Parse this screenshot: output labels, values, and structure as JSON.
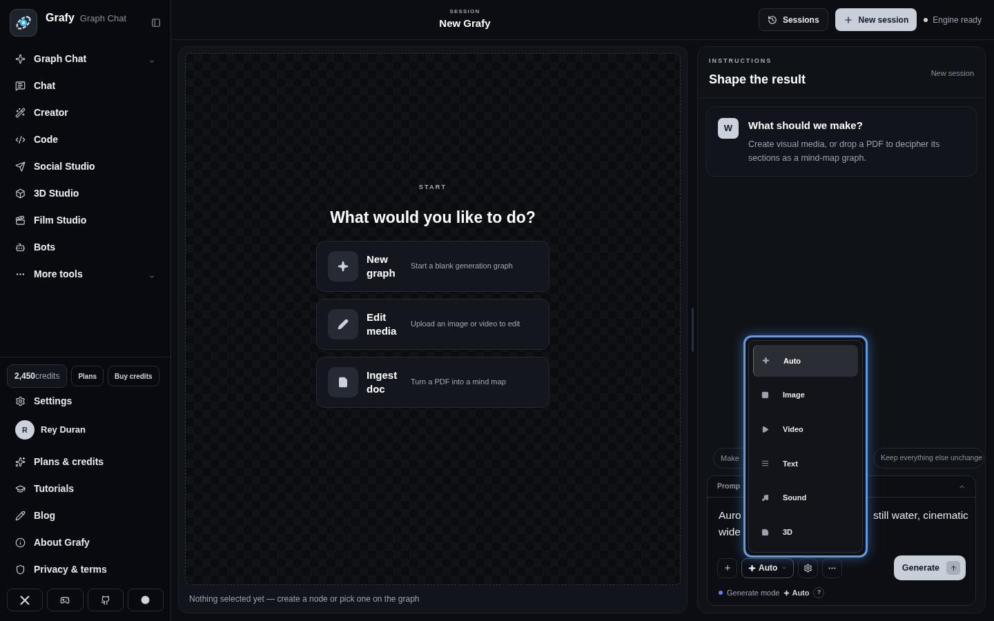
{
  "brand": {
    "name": "Grafy",
    "subtitle": "Graph Chat"
  },
  "nav": [
    {
      "label": "Graph Chat",
      "kind": "group"
    },
    {
      "label": "Chat",
      "kind": "link"
    },
    {
      "label": "Creator",
      "kind": "link"
    },
    {
      "label": "Code",
      "kind": "link"
    },
    {
      "label": "Social Studio",
      "kind": "link"
    },
    {
      "label": "3D Studio",
      "kind": "link"
    },
    {
      "label": "Film Studio",
      "kind": "link"
    },
    {
      "label": "Bots",
      "kind": "link"
    },
    {
      "label": "More tools",
      "kind": "group"
    }
  ],
  "credits": {
    "amount": "2,450",
    "unit": "credits",
    "buttons": [
      "Plans",
      "Buy credits"
    ]
  },
  "settings": "Settings",
  "user": {
    "initial": "R",
    "name": "Rey Duran"
  },
  "footer_links": [
    "Plans & credits",
    "Tutorials",
    "Blog",
    "About Grafy",
    "Privacy & terms"
  ],
  "header": {
    "label": "SESSION",
    "title": "New Grafy",
    "actions": [
      {
        "label": "Sessions",
        "kind": "secondary"
      },
      {
        "label": "New session",
        "kind": "primary"
      }
    ],
    "status": "Engine ready"
  },
  "canvas": {
    "eyebrow": "START",
    "heading": "What would you like to do?",
    "options": [
      {
        "title": "New graph",
        "description": "Start a blank generation graph"
      },
      {
        "title": "Edit media",
        "description": "Upload an image or video to edit"
      },
      {
        "title": "Ingest doc",
        "description": "Turn a PDF into a mind map"
      }
    ],
    "status": "Nothing selected yet — create a node or pick one on the graph"
  },
  "instructions": {
    "label": "INSTRUCTIONS",
    "title": "Shape the result",
    "session": "New session",
    "card": {
      "avatar": "W",
      "title": "What should we make?",
      "text": "Create visual media, or drop a PDF to decipher its sections as a mind-map graph."
    }
  },
  "chips": [
    "Make",
    "Keep everything else unchange"
  ],
  "prompt": {
    "label": "Promp",
    "left_lines": [
      "Auro",
      "wide"
    ],
    "right_text": "still water, cinematic"
  },
  "toolbar": {
    "mode": "Auto",
    "generate": "Generate",
    "footer_label": "Generate mode",
    "footer_mode": "Auto",
    "help": "?"
  },
  "menu": [
    {
      "label": "Auto",
      "selected": true
    },
    {
      "label": "Image",
      "selected": false
    },
    {
      "label": "Video",
      "selected": false
    },
    {
      "label": "Text",
      "selected": false
    },
    {
      "label": "Sound",
      "selected": false
    },
    {
      "label": "3D",
      "selected": false
    }
  ]
}
